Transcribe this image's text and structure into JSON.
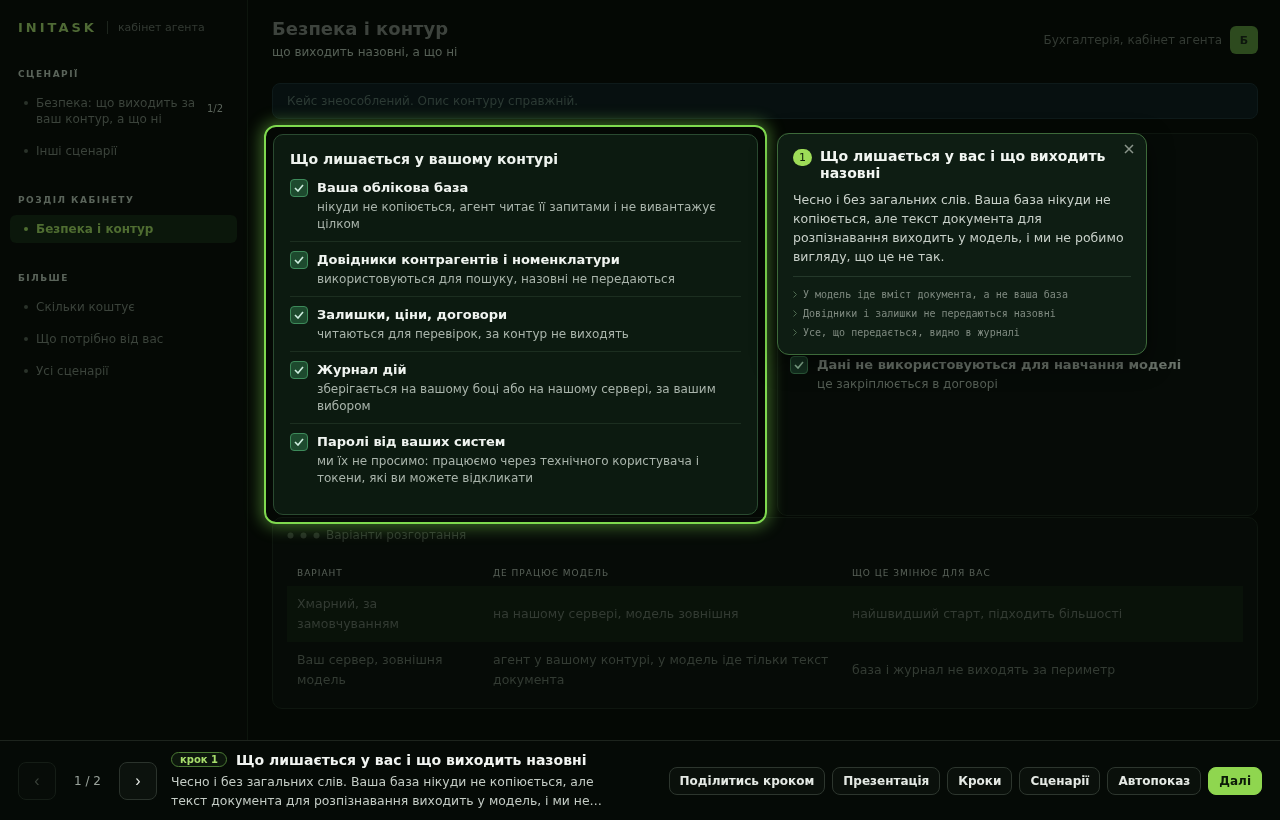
{
  "sidebar": {
    "logo": "INITASK",
    "subtitle": "кабінет агента",
    "groups": [
      {
        "heading": "СЦЕНАРІЇ",
        "items": [
          {
            "label": "Безпека: що виходить за ваш контур, а що ні",
            "badge": "1/2",
            "selected": false
          },
          {
            "label": "Інші сценарії",
            "selected": false
          }
        ]
      },
      {
        "heading": "РОЗДІЛ КАБІНЕТУ",
        "items": [
          {
            "label": "Безпека і контур",
            "selected": true
          }
        ]
      },
      {
        "heading": "БІЛЬШЕ",
        "items": [
          {
            "label": "Скільки коштує",
            "selected": false
          },
          {
            "label": "Що потрібно від вас",
            "selected": false
          },
          {
            "label": "Усі сценарії",
            "selected": false
          }
        ]
      }
    ]
  },
  "header": {
    "title": "Безпека і контур",
    "subtitle": "що виходить назовні, а що ні",
    "user": "Бухгалтерія, кабінет агента",
    "avatar": "Б"
  },
  "notice": "Кейс знеособлений. Опис контуру справжній.",
  "checklist_card": {
    "title": "Що лишається у вашому контурі",
    "items": [
      {
        "title": "Ваша облікова база",
        "desc": "нікуди не копіюється, агент читає її запитами і не вивантажує цілком",
        "checked": true
      },
      {
        "title": "Довідники контрагентів і номенклатури",
        "desc": "використовуються для пошуку, назовні не передаються",
        "checked": true
      },
      {
        "title": "Залишки, ціни, договори",
        "desc": "читаються для перевірок, за контур не виходять",
        "checked": true
      },
      {
        "title": "Журнал дій",
        "desc": "зберігається на вашому боці або на нашому сервері, за вашим вибором",
        "checked": true
      },
      {
        "title": "Паролі від ваших систем",
        "desc": "ми їх не просимо: працюємо через технічного користувача і токени, які ви можете відкликати",
        "checked": true
      }
    ]
  },
  "side_card": {
    "items": [
      {
        "title": "Дані не використовуються для навчання моделі",
        "desc": "це закріплюється в договорі",
        "checked": true
      }
    ]
  },
  "deploy": {
    "title": "Варіанти розгортання",
    "columns": [
      "ВАРІАНТ",
      "ДЕ ПРАЦЮЄ МОДЕЛЬ",
      "ЩО ЦЕ ЗМІНЮЄ ДЛЯ ВАС"
    ],
    "rows": [
      [
        "Хмарний, за замовчуванням",
        "на нашому сервері, модель зовнішня",
        "найшвидший старт, підходить більшості"
      ],
      [
        "Ваш сервер, зовнішня модель",
        "агент у вашому контурі, у модель іде тільки текст документа",
        "база і журнал не виходять за периметр"
      ]
    ]
  },
  "tooltip": {
    "step": "1",
    "title": "Що лишається у вас і що виходить назовні",
    "text": "Чесно і без загальних слів. Ваша база нікуди не копіюється, але текст документа для розпізнавання виходить у модель, і ми не робимо вигляду, що це не так.",
    "points": [
      "У модель іде вміст документа, а не ваша база",
      "Довідники і залишки не передаються назовні",
      "Усе, що передається, видно в журналі"
    ]
  },
  "bottom_bar": {
    "prev": "‹",
    "prev_disabled": true,
    "pages": "1 / 2",
    "next": "›",
    "next_disabled": false,
    "badge": "крок 1",
    "title": "Що лишається у вас і що виходить назовні",
    "text": "Чесно і без загальних слів. Ваша база нікуди не копіюється, але текст документа для розпізнавання виходить у модель, і ми не…",
    "buttons": [
      {
        "label": "Поділитись кроком",
        "primary": false
      },
      {
        "label": "Презентація",
        "primary": false
      },
      {
        "label": "Кроки",
        "primary": false
      },
      {
        "label": "Сценарії",
        "primary": false
      },
      {
        "label": "Автопоказ",
        "primary": false
      },
      {
        "label": "Далі",
        "primary": true
      }
    ]
  }
}
